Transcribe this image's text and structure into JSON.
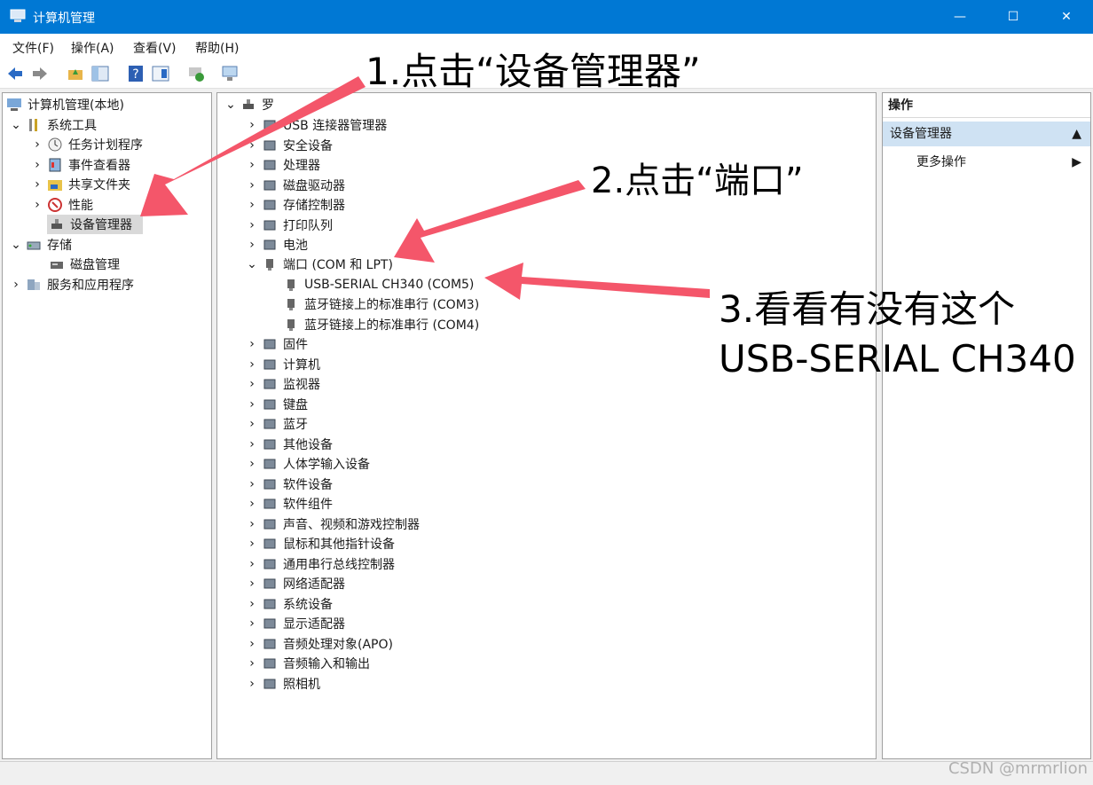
{
  "window": {
    "title": "计算机管理",
    "minimize": "—",
    "maximize": "☐",
    "close": "✕"
  },
  "menu": [
    "文件(F)",
    "操作(A)",
    "查看(V)",
    "帮助(H)"
  ],
  "left_tree": {
    "root": "计算机管理(本地)",
    "system_tools": "系统工具",
    "task_scheduler": "任务计划程序",
    "event_viewer": "事件查看器",
    "shared_folders": "共享文件夹",
    "performance": "性能",
    "device_manager": "设备管理器",
    "storage": "存储",
    "disk_management": "磁盘管理",
    "services_apps": "服务和应用程序"
  },
  "device_tree": {
    "root": "罗",
    "categories": [
      "USB 连接器管理器",
      "安全设备",
      "处理器",
      "磁盘驱动器",
      "存储控制器",
      "打印队列",
      "电池"
    ],
    "ports": {
      "label": "端口 (COM 和 LPT)",
      "children": [
        "USB-SERIAL CH340 (COM5)",
        "蓝牙链接上的标准串行 (COM3)",
        "蓝牙链接上的标准串行 (COM4)"
      ]
    },
    "categories_after": [
      "固件",
      "计算机",
      "监视器",
      "键盘",
      "蓝牙",
      "其他设备",
      "人体学输入设备",
      "软件设备",
      "软件组件",
      "声音、视频和游戏控制器",
      "鼠标和其他指针设备",
      "通用串行总线控制器",
      "网络适配器",
      "系统设备",
      "显示适配器",
      "音频处理对象(APO)",
      "音频输入和输出",
      "照相机"
    ]
  },
  "actions": {
    "header": "操作",
    "sub": "设备管理器",
    "more": "更多操作"
  },
  "annotations": {
    "step1": "1.点击“设备管理器”",
    "step2": "2.点击“端口”",
    "step3_line1": "3.看看有没有这个",
    "step3_line2": "USB-SERIAL CH340"
  },
  "watermark": "CSDN @mrmrlion",
  "colors": {
    "titlebar": "#0078d4",
    "arrow": "#f4566a",
    "selected": "#d9d9d9"
  }
}
